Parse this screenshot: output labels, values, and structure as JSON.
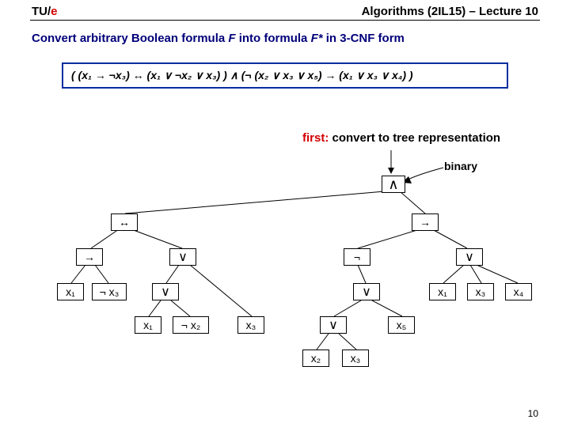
{
  "header": {
    "logo_tu": "TU",
    "logo_slash": "/",
    "logo_e": "e",
    "course": "Algorithms (2IL15) – Lecture 10"
  },
  "subtitle": {
    "prefix": "Convert arbitrary Boolean formula ",
    "F": "F",
    "mid": " into formula ",
    "Fstar": "F*",
    "suffix": " in 3-CNF form"
  },
  "formula": "( (x₁ → ¬x₃) ↔ (x₁ ∨ ¬x₂ ∨ x₃) )  ∧  (¬ (x₂ ∨ x₃ ∨ x₅) → (x₁ ∨ x₃ ∨ x₄) )",
  "first_label": "first:",
  "first_rest": " convert to tree representation",
  "binary_label": "binary",
  "page_number": "10",
  "nodes": {
    "root": "∧",
    "n_biimp": "↔",
    "n_impL": "→",
    "n_x1L": "x₁",
    "n_notx3": "¬ x₃",
    "n_or1": "∨",
    "n_or1b": "∨",
    "n_x1b": "x₁",
    "n_notx2": "¬ x₂",
    "n_x3b": "x₃",
    "n_impR": "→",
    "n_neg": "¬",
    "n_or2": "∨",
    "n_or2b": "∨",
    "n_x2": "x₂",
    "n_x3c": "x₃",
    "n_x5": "x₅",
    "n_or3": "∨",
    "n_x1c": "x₁",
    "n_x3d": "x₃",
    "n_x4": "x₄"
  },
  "chart_data": {
    "type": "tree",
    "description": "Boolean formula parse tree (binary)",
    "nodes": [
      {
        "id": "root",
        "label": "∧",
        "children": [
          "biimp",
          "impR"
        ]
      },
      {
        "id": "biimp",
        "label": "↔",
        "children": [
          "impL",
          "or1"
        ]
      },
      {
        "id": "impL",
        "label": "→",
        "children": [
          "x1L",
          "notx3"
        ]
      },
      {
        "id": "x1L",
        "label": "x₁"
      },
      {
        "id": "notx3",
        "label": "¬x₃"
      },
      {
        "id": "or1",
        "label": "∨",
        "children": [
          "or1b",
          "x3b"
        ]
      },
      {
        "id": "or1b",
        "label": "∨",
        "children": [
          "x1b",
          "notx2"
        ]
      },
      {
        "id": "x1b",
        "label": "x₁"
      },
      {
        "id": "notx2",
        "label": "¬x₂"
      },
      {
        "id": "x3b",
        "label": "x₃"
      },
      {
        "id": "impR",
        "label": "→",
        "children": [
          "neg",
          "or3"
        ]
      },
      {
        "id": "neg",
        "label": "¬",
        "children": [
          "or2"
        ]
      },
      {
        "id": "or2",
        "label": "∨",
        "children": [
          "or2b",
          "x5"
        ]
      },
      {
        "id": "or2b",
        "label": "∨",
        "children": [
          "x2",
          "x3c"
        ]
      },
      {
        "id": "x2",
        "label": "x₂"
      },
      {
        "id": "x3c",
        "label": "x₃"
      },
      {
        "id": "x5",
        "label": "x₅"
      },
      {
        "id": "or3",
        "label": "∨",
        "children": [
          "x1c",
          "x3d",
          "x4"
        ]
      },
      {
        "id": "x1c",
        "label": "x₁"
      },
      {
        "id": "x3d",
        "label": "x₃"
      },
      {
        "id": "x4",
        "label": "x₄"
      }
    ]
  }
}
